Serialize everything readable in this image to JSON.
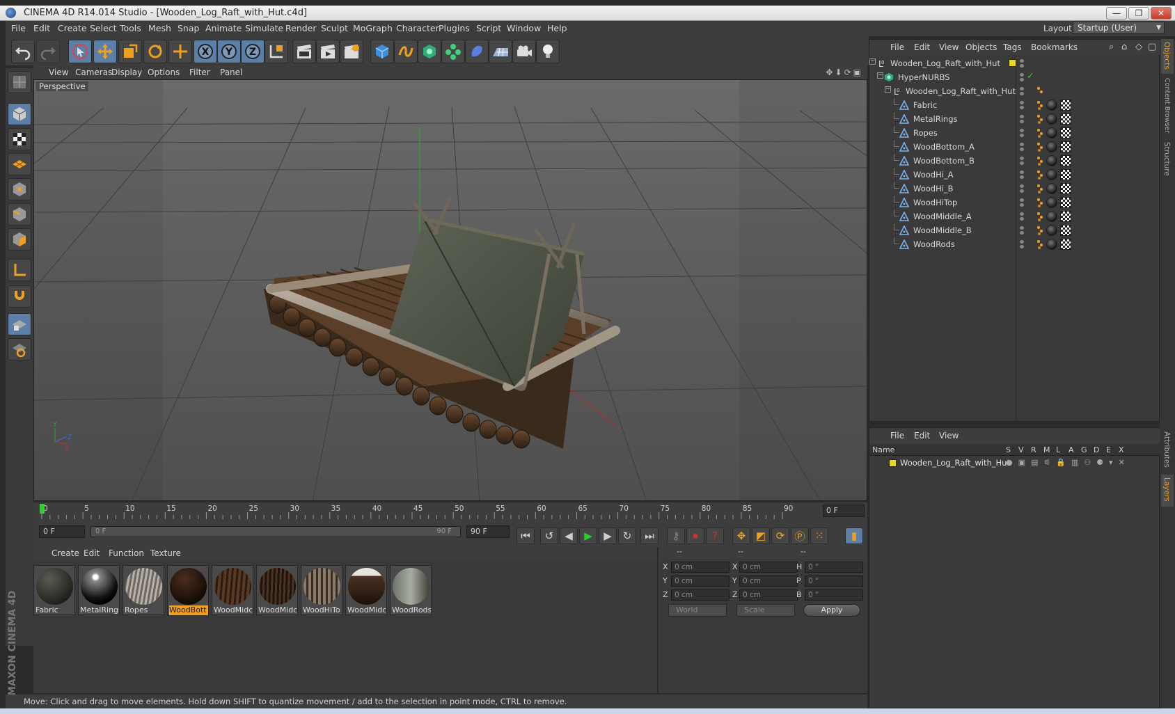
{
  "window": {
    "title": "CINEMA 4D R14.014 Studio - [Wooden_Log_Raft_with_Hut.c4d]",
    "minimize": "—",
    "maximize": "❐",
    "close": "✕"
  },
  "menu": [
    "File",
    "Edit",
    "Create",
    "Select",
    "Tools",
    "Mesh",
    "Snap",
    "Animate",
    "Simulate",
    "Render",
    "Sculpt",
    "MoGraph",
    "Character",
    "Plugins",
    "Script",
    "Window",
    "Help"
  ],
  "layout": {
    "label": "Layout:",
    "value": "Startup (User)"
  },
  "viewport": {
    "menu": [
      "View",
      "Cameras",
      "Display",
      "Options",
      "Filter",
      "Panel"
    ],
    "label": "Perspective"
  },
  "timeline": {
    "ticks": [
      "0",
      "5",
      "10",
      "15",
      "20",
      "25",
      "30",
      "35",
      "40",
      "45",
      "50",
      "55",
      "60",
      "65",
      "70",
      "75",
      "80",
      "85",
      "90"
    ],
    "current_frame": "0 F"
  },
  "transport": {
    "start_field": "0 F",
    "range_start": "0 F",
    "range_end": "90 F",
    "end_field": "90 F"
  },
  "materials": {
    "menu": [
      "Create",
      "Edit",
      "Function",
      "Texture"
    ],
    "items": [
      {
        "label": "Fabric"
      },
      {
        "label": "MetalRings"
      },
      {
        "label": "Ropes"
      },
      {
        "label": "WoodBott"
      },
      {
        "label": "WoodMidc"
      },
      {
        "label": "WoodMidc"
      },
      {
        "label": "WoodHiTo"
      },
      {
        "label": "WoodMidc"
      },
      {
        "label": "WoodRods"
      }
    ],
    "selected_index": 3
  },
  "coords": {
    "headers": [
      "--",
      "--",
      "--"
    ],
    "rows": [
      {
        "a": "X",
        "av": "0 cm",
        "b": "X",
        "bv": "0 cm",
        "c": "H",
        "cv": "0 °"
      },
      {
        "a": "Y",
        "av": "0 cm",
        "b": "Y",
        "bv": "0 cm",
        "c": "P",
        "cv": "0 °"
      },
      {
        "a": "Z",
        "av": "0 cm",
        "b": "Z",
        "bv": "0 cm",
        "c": "B",
        "cv": "0 °"
      }
    ],
    "mode": "World",
    "transform": "Scale",
    "apply": "Apply"
  },
  "status": "Move: Click and drag to move elements. Hold down SHIFT to quantize movement / add to the selection in point mode, CTRL to remove.",
  "objects": {
    "menu": [
      "File",
      "Edit",
      "View",
      "Objects",
      "Tags",
      "Bookmarks"
    ],
    "tree": [
      {
        "name": "Wooden_Log_Raft_with_Hut",
        "level": 0,
        "type": "null"
      },
      {
        "name": "HyperNURBS",
        "level": 1,
        "type": "nurbs"
      },
      {
        "name": "Wooden_Log_Raft_with_Hut",
        "level": 2,
        "type": "null"
      },
      {
        "name": "Fabric",
        "level": 3,
        "type": "mesh"
      },
      {
        "name": "MetalRings",
        "level": 3,
        "type": "mesh"
      },
      {
        "name": "Ropes",
        "level": 3,
        "type": "mesh"
      },
      {
        "name": "WoodBottom_A",
        "level": 3,
        "type": "mesh"
      },
      {
        "name": "WoodBottom_B",
        "level": 3,
        "type": "mesh"
      },
      {
        "name": "WoodHi_A",
        "level": 3,
        "type": "mesh"
      },
      {
        "name": "WoodHi_B",
        "level": 3,
        "type": "mesh"
      },
      {
        "name": "WoodHiTop",
        "level": 3,
        "type": "mesh"
      },
      {
        "name": "WoodMiddle_A",
        "level": 3,
        "type": "mesh"
      },
      {
        "name": "WoodMiddle_B",
        "level": 3,
        "type": "mesh"
      },
      {
        "name": "WoodRods",
        "level": 3,
        "type": "mesh"
      }
    ]
  },
  "layers": {
    "menu": [
      "File",
      "Edit",
      "View"
    ],
    "columns": [
      "Name",
      "S",
      "V",
      "R",
      "M",
      "L",
      "A",
      "G",
      "D",
      "E",
      "X"
    ],
    "rows": [
      {
        "name": "Wooden_Log_Raft_with_Hut",
        "color": "#e8d820"
      }
    ]
  },
  "side_tabs": [
    "Objects",
    "Content Browser",
    "Structure",
    "Attributes",
    "Layers"
  ],
  "brand": "MAXON CINEMA 4D",
  "colors": {
    "accent": "#f0a020",
    "active_tool": "#5b7fa6",
    "layer_yellow": "#e8d820"
  }
}
